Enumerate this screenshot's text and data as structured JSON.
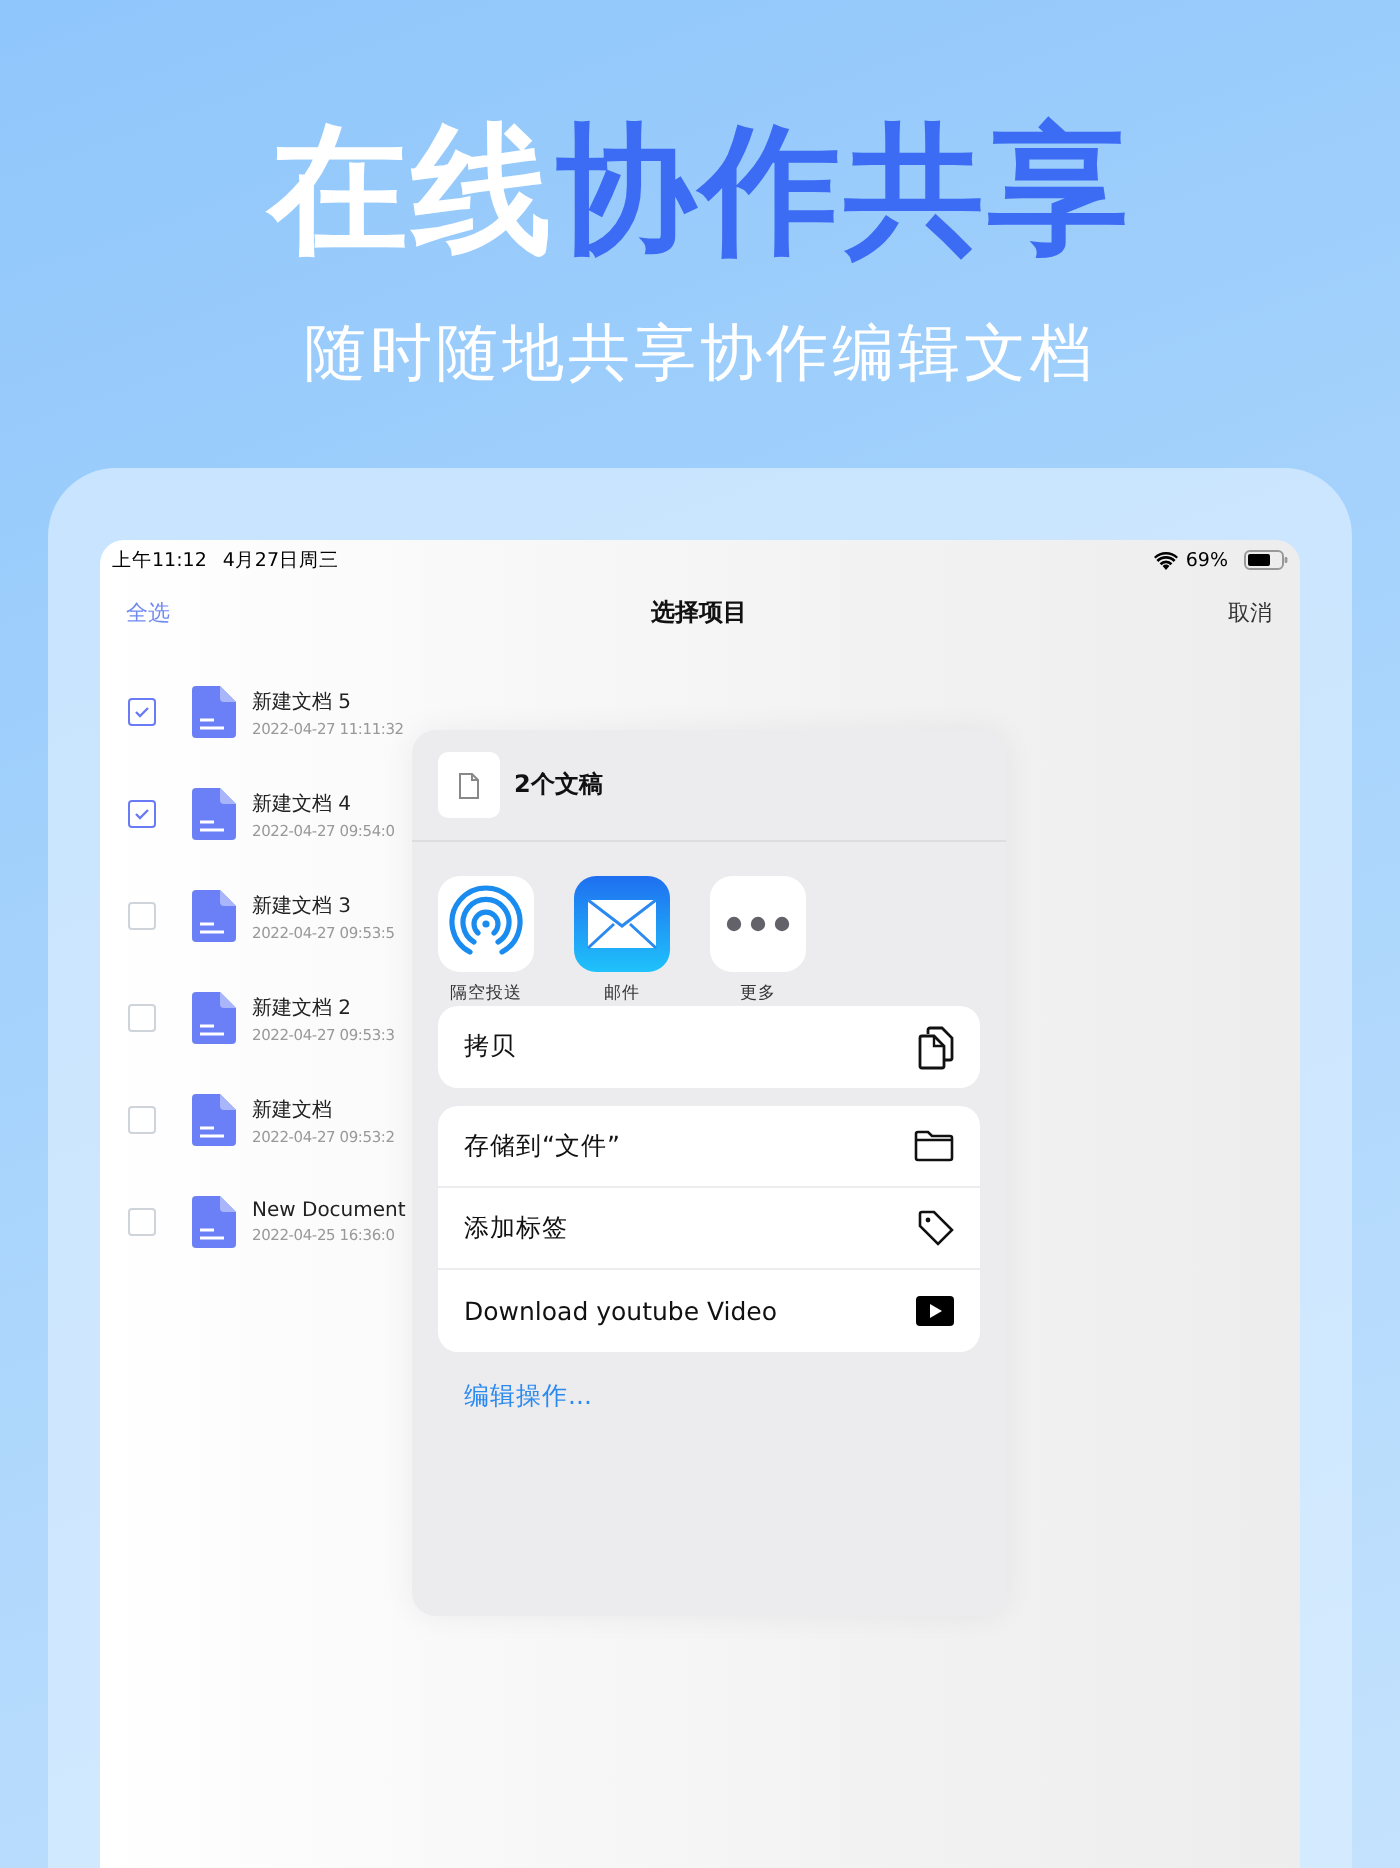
{
  "headline": [
    {
      "text": "在线",
      "kind": "plain"
    },
    {
      "text": "协作共享",
      "kind": "accent"
    }
  ],
  "subtitle": "随时随地共享协作编辑文档",
  "status_bar": {
    "time": "上午11:12",
    "date": "4月27日周三",
    "battery": "69%"
  },
  "nav": {
    "left": "全选",
    "title": "选择项目",
    "right": "取消"
  },
  "documents": [
    {
      "name": "新建文档 5",
      "date": "2022-04-27 11:11:32",
      "checked": true
    },
    {
      "name": "新建文档 4",
      "date": "2022-04-27 09:54:0",
      "checked": true
    },
    {
      "name": "新建文档 3",
      "date": "2022-04-27 09:53:5",
      "checked": false
    },
    {
      "name": "新建文档 2",
      "date": "2022-04-27 09:53:3",
      "checked": false
    },
    {
      "name": "新建文档",
      "date": "2022-04-27 09:53:2",
      "checked": false
    },
    {
      "name": "New Document",
      "date": "2022-04-25 16:36:0",
      "checked": false
    }
  ],
  "share_sheet": {
    "title": "2个文稿",
    "apps": [
      {
        "label": "隔空投送",
        "kind": "airdrop"
      },
      {
        "label": "邮件",
        "kind": "mail"
      },
      {
        "label": "更多",
        "kind": "more"
      }
    ],
    "action_groups": [
      [
        {
          "label": "拷贝",
          "kind": "copy"
        }
      ],
      [
        {
          "label": "存储到“文件”",
          "kind": "folder"
        },
        {
          "label": "添加标签",
          "kind": "tag"
        },
        {
          "label": "Download youtube Video",
          "kind": "video"
        }
      ]
    ],
    "edit_actions": "编辑操作..."
  }
}
